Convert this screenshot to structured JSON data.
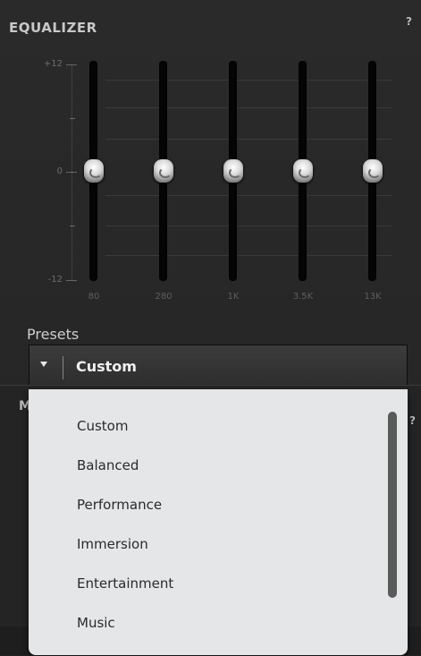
{
  "equalizer": {
    "title": "EQUALIZER",
    "help": "?",
    "scale": {
      "top": "+12",
      "mid": "0",
      "bottom": "-12"
    },
    "bands": [
      {
        "label": "80",
        "gain_db": 0
      },
      {
        "label": "280",
        "gain_db": 0
      },
      {
        "label": "1K",
        "gain_db": 0
      },
      {
        "label": "3.5K",
        "gain_db": 0
      },
      {
        "label": "13K",
        "gain_db": 0
      }
    ],
    "gain_range_db": [
      -12,
      12
    ]
  },
  "presets": {
    "label": "Presets",
    "selected": "Custom",
    "options": [
      "Custom",
      "Balanced",
      "Performance",
      "Immersion",
      "Entertainment",
      "Music"
    ]
  },
  "lower_section": {
    "title_partial": "M",
    "help": "?"
  },
  "colors": {
    "panel_bg": "#262626",
    "dropdown_bg": "#e4e6e8",
    "track": "#050505",
    "text_light": "#cfcfcf"
  }
}
